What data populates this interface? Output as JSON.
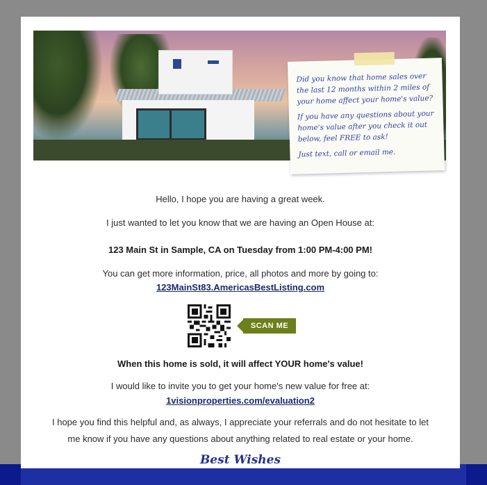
{
  "note": {
    "paragraph1": "Did you know that home sales over the last 12 months within 2 miles of your home affect your home's value?",
    "paragraph2": "If you have any questions about your home's value after you check it out below, feel FREE to ask!",
    "paragraph3": "Just text, call or email me."
  },
  "email": {
    "greeting": "Hello, I hope you are having a great week.",
    "intro": "I just wanted to let you know that we are having an Open House at:",
    "open_house": "123 Main St in Sample, CA on Tuesday from 1:00 PM-4:00 PM!",
    "more_info": "You can get more information, price, all photos and more by going to:",
    "listing_link": "123MainSt83.AmericasBestListing.com",
    "scan_label": "SCAN ME",
    "sold_notice": "When this home is sold, it will affect YOUR home's value!",
    "invite": "I would like to invite you to get your home's new value for free at:",
    "evaluation_link": "1visionproperties.com/evaluation2",
    "closing_line1": "I hope you find this helpful and, as always, I appreciate your referrals and do not hesitate to let",
    "closing_line2": "me know if you have any questions about anything related to real estate or your home.",
    "signature": "Best Wishes"
  },
  "colors": {
    "accent_green": "#6b7f1b",
    "link_blue": "#1a2a6c",
    "note_ink": "#2f3fa0",
    "frame_gray": "#8a8a8a",
    "bottom_bar": "#1e2fa3"
  },
  "icons": {
    "qr": "qr-code-icon",
    "arrow": "arrow-left-icon"
  }
}
